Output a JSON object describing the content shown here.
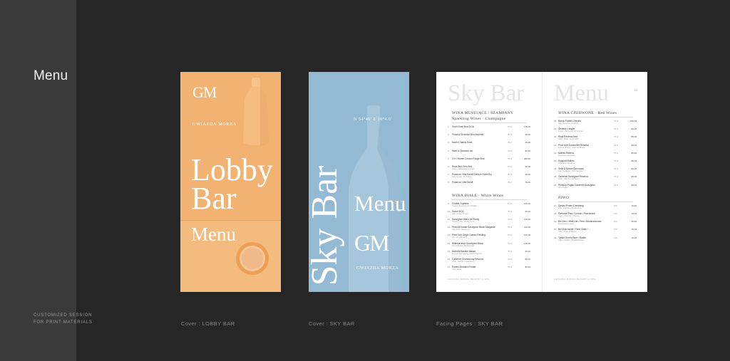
{
  "sidebar": {
    "title": "Menu",
    "footer_line1": "CUSTOMIZED SESSION",
    "footer_line2": "FOR PRINT MATERIALS"
  },
  "captions": {
    "lobby": "Cover : LOBBY BAR",
    "sky": "Cover : SKY BAR",
    "spread": "Facing Pages : SKY BAR"
  },
  "colors": {
    "background": "#262626",
    "sidebar": "#3a3a3a",
    "lobby_orange": "#f2b372",
    "sky_blue": "#93b9d3"
  },
  "lobby_cover": {
    "logo": "GM",
    "brand": "GWIAZDA MORZA",
    "title_line1": "Lobby",
    "title_line2": "Bar",
    "subtitle": "Menu"
  },
  "sky_cover": {
    "vertical_title": "Sky Bar",
    "coordinates": "N 54°46' E 18°4.6'",
    "subtitle": "Menu",
    "logo": "GM",
    "brand": "GWIAZDA MORZA"
  },
  "spread": {
    "left_title": "Sky Bar",
    "right_title": "Menu",
    "left_sections": [
      {
        "title": "WINA MUSUJĄCE / SZAMPANY",
        "subtitle": "Sparkling Wines · Champagne",
        "items": [
          {
            "num": "1.",
            "name": "Gosh Rosé Brut 2016",
            "desc": "",
            "unit": "75 cl",
            "price": "175,00"
          },
          {
            "num": "2.",
            "name": "Prosé & Chandon Brut Imperial",
            "desc": "",
            "unit": "75 cl",
            "price": "95,00"
          },
          {
            "num": "3.",
            "name": "Monfil Chablis Rosé",
            "desc": "",
            "unit": "75 cl",
            "price": "45,00"
          },
          {
            "num": "4.",
            "name": "Moët & Chandon Ice",
            "desc": "",
            "unit": "75 cl",
            "price": "80,00"
          },
          {
            "num": "5.",
            "name": "G.H. Mumm Cordon Rouge Brut",
            "desc": "",
            "unit": "75 cl",
            "price": "280,00"
          },
          {
            "num": "6.",
            "name": "Rosé Brut Zero Brut",
            "desc": "Spain, Catalonia, Del Cava",
            "unit": "75 cl",
            "price": "55,00"
          },
          {
            "num": "7.",
            "name": "Prosecco Villa Sandi Cartizze Extra Dry",
            "desc": "Italy, Veneto, Dei Tesoro",
            "unit": "75 cl",
            "price": "95,00"
          },
          {
            "num": "8.",
            "name": "Prosecco Villa Sandi",
            "desc": "",
            "unit": "75 cl",
            "price": "75,00"
          }
        ]
      },
      {
        "title": "WINA BIAŁE · White Wines",
        "subtitle": "",
        "items": [
          {
            "num": "9.",
            "name": "Chablis Joyfame",
            "desc": "France, Burgundy, AC Chablis",
            "unit": "75 cl",
            "price": "120,00"
          },
          {
            "num": "10.",
            "name": "Soave DOC",
            "desc": "Italy, Veneto, Soave",
            "unit": "75 cl",
            "price": "95,00"
          },
          {
            "num": "11.",
            "name": "Sauvignon Blanc de Rochy",
            "desc": "France, Loire, Pouilly Fumé",
            "unit": "75 cl",
            "price": "110,00"
          },
          {
            "num": "12.",
            "name": "Pescina Estate Sauvignon Blanc Margarita",
            "desc": "Italy, Friuli, Sauvignon",
            "unit": "75 cl",
            "price": "140,00"
          },
          {
            "num": "13.",
            "name": "Pinot Noir Grigio Classic Riesling",
            "desc": "Germany, Riesling",
            "unit": "75 cl",
            "price": "125,00"
          },
          {
            "num": "14.",
            "name": "Wildeperssch Sauvignon Blanc",
            "desc": "New Zealand, Marlborough",
            "unit": "75 cl",
            "price": "115,00"
          },
          {
            "num": "15.",
            "name": "Mortella Bastide Alsace",
            "desc": "France, Bourgogne, Gewürztraminer",
            "unit": "75 cl",
            "price": "95,00"
          },
          {
            "num": "16.",
            "name": "Cabernet Chardonnay Reserva",
            "desc": "Chile, Valle de Casablanca",
            "unit": "75 cl",
            "price": "85,00"
          },
          {
            "num": "17.",
            "name": "Robert Mondavi Private",
            "desc": "USA, Napa",
            "unit": "75 cl",
            "price": "95,00"
          }
        ]
      }
    ],
    "right_sections": [
      {
        "title": "WINA CZERWONE · Red Wines",
        "subtitle": "",
        "items": [
          {
            "num": "18.",
            "name": "Barolo Fratelli Gheddu",
            "desc": "Italy, Piemonte, Nebbiolo",
            "unit": "75 cl",
            "price": "210,00"
          },
          {
            "num": "19.",
            "name": "Château Langlet",
            "desc": "France, Bordeaux, AC Graves",
            "unit": "75 cl",
            "price": "95,00"
          },
          {
            "num": "20.",
            "name": "Rioja Reserva Vina",
            "desc": "Spain, Rioja, Tempranillo",
            "unit": "75 cl",
            "price": "85,00"
          },
          {
            "num": "21.",
            "name": "Pinot Noir Sommelier Reserva",
            "desc": "France, Rhône, Côtes du Rhône",
            "unit": "75 cl",
            "price": "95,00"
          },
          {
            "num": "22.",
            "name": "Malbec Riserva",
            "desc": "Argentina, Mendoza",
            "unit": "75 cl",
            "price": "95,00"
          },
          {
            "num": "23.",
            "name": "Esquina Malbec",
            "desc": "Argentina, Mendoza",
            "unit": "75 cl",
            "price": "95,00"
          },
          {
            "num": "24.",
            "name": "Sella & Mosca Cannonau",
            "desc": "Italy, Sardegna, DOC Sardinia",
            "unit": "75 cl",
            "price": "95,00"
          },
          {
            "num": "25.",
            "name": "Cabernet Sauvignon Reserva",
            "desc": "Chile, Valle de Colchagua",
            "unit": "75 cl",
            "price": "95,00"
          },
          {
            "num": "26.",
            "name": "Primitivo Puglia Cabernet Sauvignon",
            "desc": "Italy, Puglia",
            "unit": "75 cl",
            "price": "95,00"
          }
        ]
      },
      {
        "title": "PIWO",
        "subtitle": "",
        "items": [
          {
            "num": "27.",
            "name": "Żywiec Porter (Carlsberg)",
            "desc": "Malt / Hopcore / Karamelowy",
            "unit": "0,5 l",
            "price": "15,00"
          },
          {
            "num": "28.",
            "name": "Pierwsze Piwo / Lemon / Pszeniczne",
            "desc": "Lager / Pale Ale / Ciemne",
            "unit": "0,5 l",
            "price": "15,00"
          },
          {
            "num": "29.",
            "name": "Bo! Zero / Wolf-Lite / Free / Bezalkoholowe",
            "desc": "Pszeniczne / Lager",
            "unit": "0,5 l",
            "price": "15,00"
          },
          {
            "num": "30.",
            "name": "Bo! Zrób swoje / Fonn Cider / ...",
            "desc": "Cider / Piwo smakowe",
            "unit": "0,5 l",
            "price": "15,00"
          },
          {
            "num": "31.",
            "name": "Tyskie Gronie Beer / Radler",
            "desc": "Lager / Radler / Bezalkoholowe",
            "unit": "0,5 l",
            "price": "15,00"
          }
        ]
      }
    ],
    "left_footer": "GWIAZDA MORZA RESORT & SPA",
    "left_page_no": "",
    "right_footer": "GWIAZDA MORZA RESORT & SPA",
    "right_page_no": "33"
  }
}
